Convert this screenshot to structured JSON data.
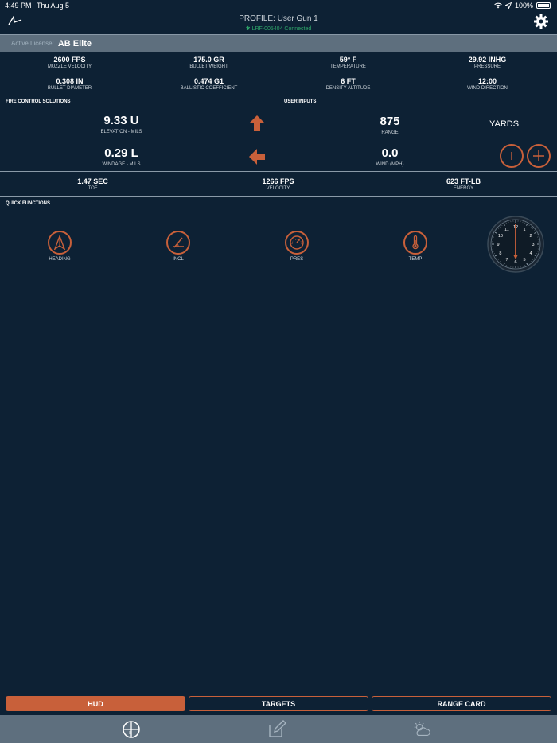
{
  "statusbar": {
    "time": "4:49 PM",
    "date": "Thu Aug 5",
    "battery": "100%"
  },
  "header": {
    "title": "PROFILE: User Gun 1",
    "connection": "LRF-005404 Connected"
  },
  "license": {
    "label": "Active License:",
    "value": "AB Elite"
  },
  "environment": [
    {
      "value": "2600 FPS",
      "label": "MUZZLE VELOCITY"
    },
    {
      "value": "175.0 GR",
      "label": "BULLET WEIGHT"
    },
    {
      "value": "59° F",
      "label": "TEMPERATURE"
    },
    {
      "value": "29.92 INHG",
      "label": "PRESSURE"
    },
    {
      "value": "0.308 IN",
      "label": "BULLET DIAMETER"
    },
    {
      "value": "0.474 G1",
      "label": "BALLISTIC COEFFICIENT"
    },
    {
      "value": "6 FT",
      "label": "DENSITY ALTITUDE"
    },
    {
      "value": "12:00",
      "label": "WIND DIRECTION"
    }
  ],
  "fire_control": {
    "title": "FIRE CONTROL SOLUTIONS",
    "elevation_value": "9.33 U",
    "elevation_label": "ELEVATION - MILS",
    "windage_value": "0.29 L",
    "windage_label": "WINDAGE - MILS"
  },
  "user_inputs": {
    "title": "USER INPUTS",
    "range_value": "875",
    "range_label": "RANGE",
    "unit": "YARDS",
    "wind_value": "0.0",
    "wind_label": "WIND (MPH)"
  },
  "results": [
    {
      "value": "1.47 SEC",
      "label": "TOF"
    },
    {
      "value": "1266 FPS",
      "label": "VELOCITY"
    },
    {
      "value": "623 FT-LB",
      "label": "ENERGY"
    }
  ],
  "quick_functions": {
    "title": "QUICK FUNCTIONS",
    "items": [
      {
        "label": "HEADING",
        "icon": "heading-icon"
      },
      {
        "label": "INCL",
        "icon": "inclination-icon"
      },
      {
        "label": "PRES",
        "icon": "pressure-gauge-icon"
      },
      {
        "label": "TEMP",
        "icon": "thermometer-icon"
      }
    ]
  },
  "wind_clock": {
    "numbers": [
      "12",
      "1",
      "2",
      "3",
      "4",
      "5",
      "6",
      "7",
      "8",
      "9",
      "10",
      "11"
    ],
    "hour": 12
  },
  "tabs": {
    "hud": "HUD",
    "targets": "TARGETS",
    "range_card": "RANGE CARD"
  },
  "colors": {
    "accent": "#c8603a",
    "background": "#0d2134",
    "bar": "#5e6f7e",
    "connected": "#2ea86a"
  }
}
